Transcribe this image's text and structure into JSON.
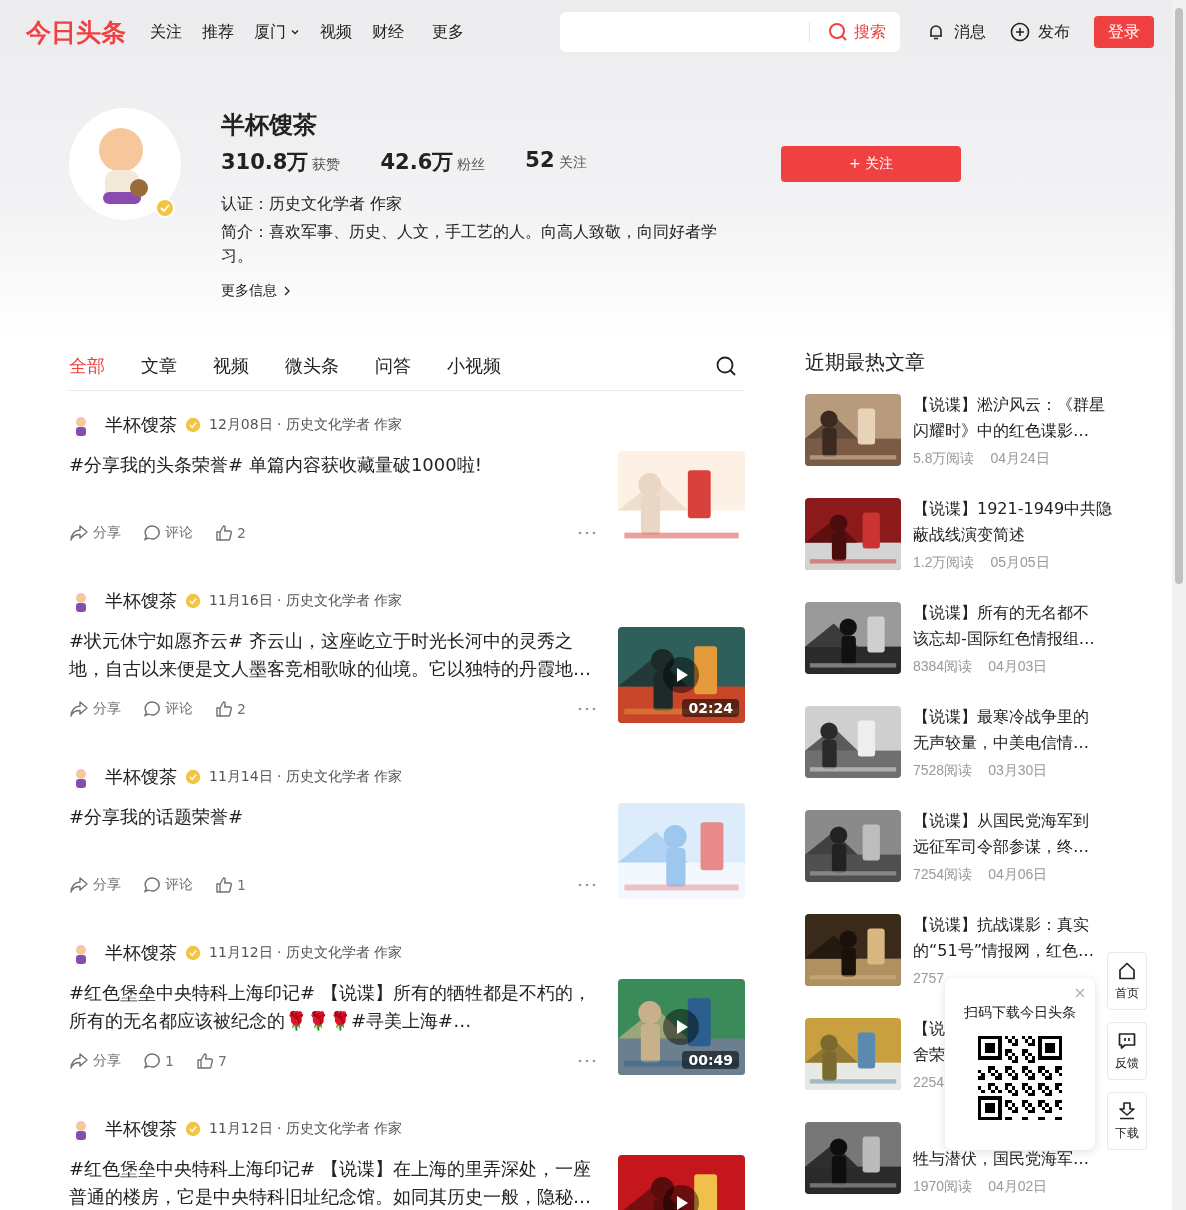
{
  "header": {
    "logo": "今日头条",
    "nav": [
      {
        "label": "关注",
        "dropdown": false
      },
      {
        "label": "推荐",
        "dropdown": false
      },
      {
        "label": "厦门",
        "dropdown": true
      },
      {
        "label": "视频",
        "dropdown": false
      },
      {
        "label": "财经",
        "dropdown": false
      },
      {
        "label": "更多",
        "dropdown": false
      }
    ],
    "search_button": "搜索",
    "messages": "消息",
    "publish": "发布",
    "login": "登录"
  },
  "profile": {
    "name": "半杯馊茶",
    "stats": [
      {
        "value": "310.8万",
        "label": "获赞"
      },
      {
        "value": "42.6万",
        "label": "粉丝"
      },
      {
        "value": "52",
        "label": "关注"
      }
    ],
    "verified": true,
    "certification": "认证：历史文化学者 作家",
    "intro": "简介：喜欢军事、历史、人文，手工艺的人。向高人致敬，向同好者学习。",
    "more": "更多信息",
    "follow_button": "+ 关注"
  },
  "tabs": [
    {
      "label": "全部",
      "selected": true
    },
    {
      "label": "文章",
      "selected": false
    },
    {
      "label": "视频",
      "selected": false
    },
    {
      "label": "微头条",
      "selected": false
    },
    {
      "label": "问答",
      "selected": false
    },
    {
      "label": "小视频",
      "selected": false
    }
  ],
  "posts": [
    {
      "author": "半杯馊茶",
      "meta": "12月08日 · 历史文化学者 作家",
      "text": "#分享我的头条荣誉# 单篇内容获收藏量破1000啦!",
      "actions": {
        "share": "分享",
        "comment": "评论",
        "like": "2"
      }
    },
    {
      "author": "半杯馊茶",
      "meta": "11月16日 · 历史文化学者 作家",
      "text": "#状元休宁如愿齐云# 齐云山，这座屹立于时光长河中的灵秀之地，自古以来便是文人墨客竞相歌咏的仙境。它以独特的丹霞地…",
      "thumb": {
        "kind": "video",
        "duration": "02:24"
      },
      "actions": {
        "share": "分享",
        "comment": "评论",
        "like": "2"
      }
    },
    {
      "author": "半杯馊茶",
      "meta": "11月14日 · 历史文化学者 作家",
      "text": "#分享我的话题荣誉#",
      "actions": {
        "share": "分享",
        "comment": "评论",
        "like": "1"
      }
    },
    {
      "author": "半杯馊茶",
      "meta": "11月12日 · 历史文化学者 作家",
      "text": "#红色堡垒中央特科上海印记# 【说谍】所有的牺牲都是不朽的，所有的无名都应该被纪念的🌹🌹🌹#寻美上海#…",
      "thumb": {
        "kind": "video",
        "duration": "00:49"
      },
      "actions": {
        "share": "分享",
        "comment": "1",
        "like": "7"
      }
    },
    {
      "author": "半杯馊茶",
      "meta": "11月12日 · 历史文化学者 作家",
      "text": "#红色堡垒中央特科上海印记# 【说谍】在上海的里弄深处，一座普通的楼房，它是中央特科旧址纪念馆。如同其历史一般，隐秘…",
      "thumb": {
        "kind": "video"
      }
    }
  ],
  "hot": {
    "title": "近期最热文章",
    "items": [
      {
        "title_lines": [
          "【说谍】淞沪风云：《群星",
          "闪耀时》中的红色谍影…"
        ],
        "reads": "5.8万阅读",
        "date": "04月24日"
      },
      {
        "title_lines": [
          "【说谍】1921-1949中共隐",
          "蔽战线演变简述"
        ],
        "reads": "1.2万阅读",
        "date": "05月05日"
      },
      {
        "title_lines": [
          "【说谍】所有的无名都不",
          "该忘却-国际红色情报组…"
        ],
        "reads": "8384阅读",
        "date": "04月03日"
      },
      {
        "title_lines": [
          "【说谍】最寒冷战争里的",
          "无声较量，中美电信情…"
        ],
        "reads": "7528阅读",
        "date": "03月30日"
      },
      {
        "title_lines": [
          "【说谍】从国民党海军到",
          "远征军司令部参谋，终…"
        ],
        "reads": "7254阅读",
        "date": "04月06日"
      },
      {
        "title_lines": [
          "【说谍】抗战谍影：真实",
          "的“51号”情报网，红色…"
        ],
        "reads": "2757"
      },
      {
        "title_lines": [
          "【说",
          "舍荣"
        ],
        "reads": "2254"
      },
      {
        "title_lines": [
          "牲与潜伏，国民党海军…"
        ],
        "first_line_covered": true,
        "reads": "1970阅读",
        "date": "04月02日"
      }
    ]
  },
  "qr_popup": {
    "title": "扫码下载今日头条"
  },
  "side_tools": [
    {
      "kind": "home",
      "label": "首页"
    },
    {
      "kind": "feedback",
      "label": "反馈"
    },
    {
      "kind": "download",
      "label": "下载"
    }
  ]
}
